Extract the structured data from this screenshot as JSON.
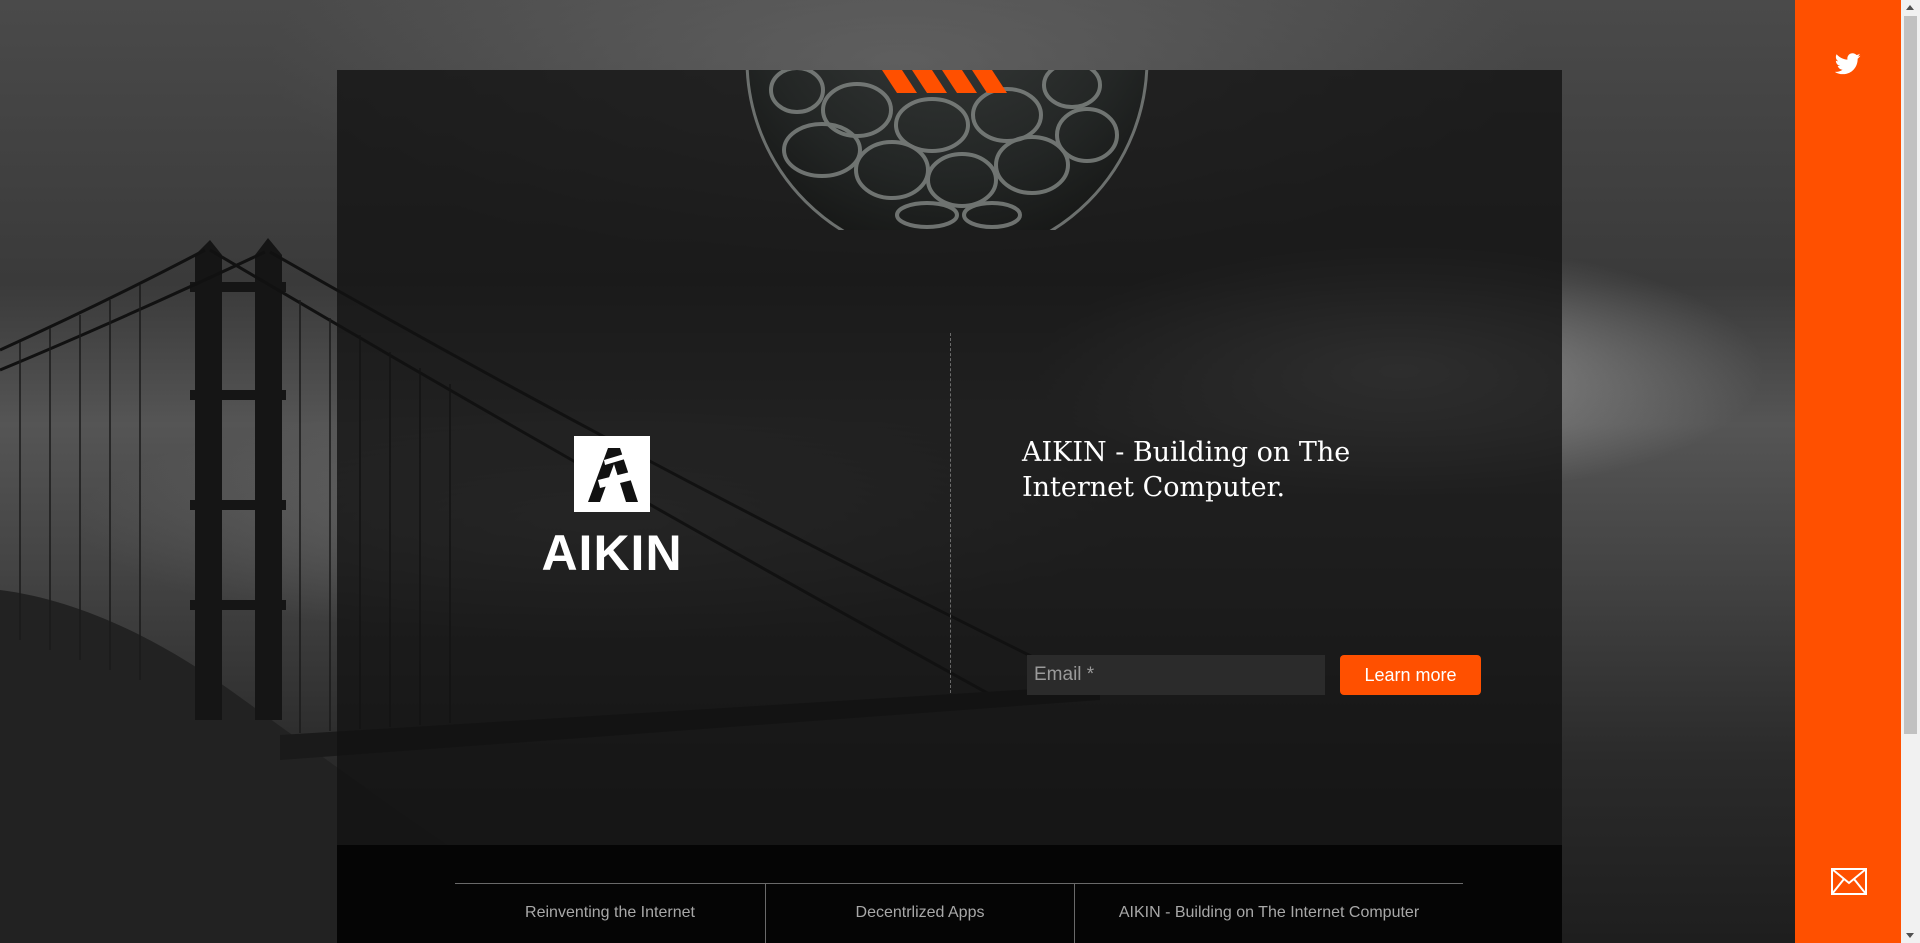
{
  "brand": {
    "name": "AIKIN",
    "accent_color": "#ff5000",
    "logo_icon": "aikin-logo-icon"
  },
  "hero": {
    "headline": "AIKIN - Building on The Internet Computer.",
    "email_placeholder": "Email *",
    "cta_label": "Learn more"
  },
  "footer": {
    "links": [
      {
        "label": "Reinventing the Internet"
      },
      {
        "label": "Decentrlized Apps"
      },
      {
        "label": "AIKIN - Building on The Internet Computer"
      }
    ]
  },
  "sidebar": {
    "icons": [
      "twitter-icon",
      "mail-icon"
    ]
  }
}
